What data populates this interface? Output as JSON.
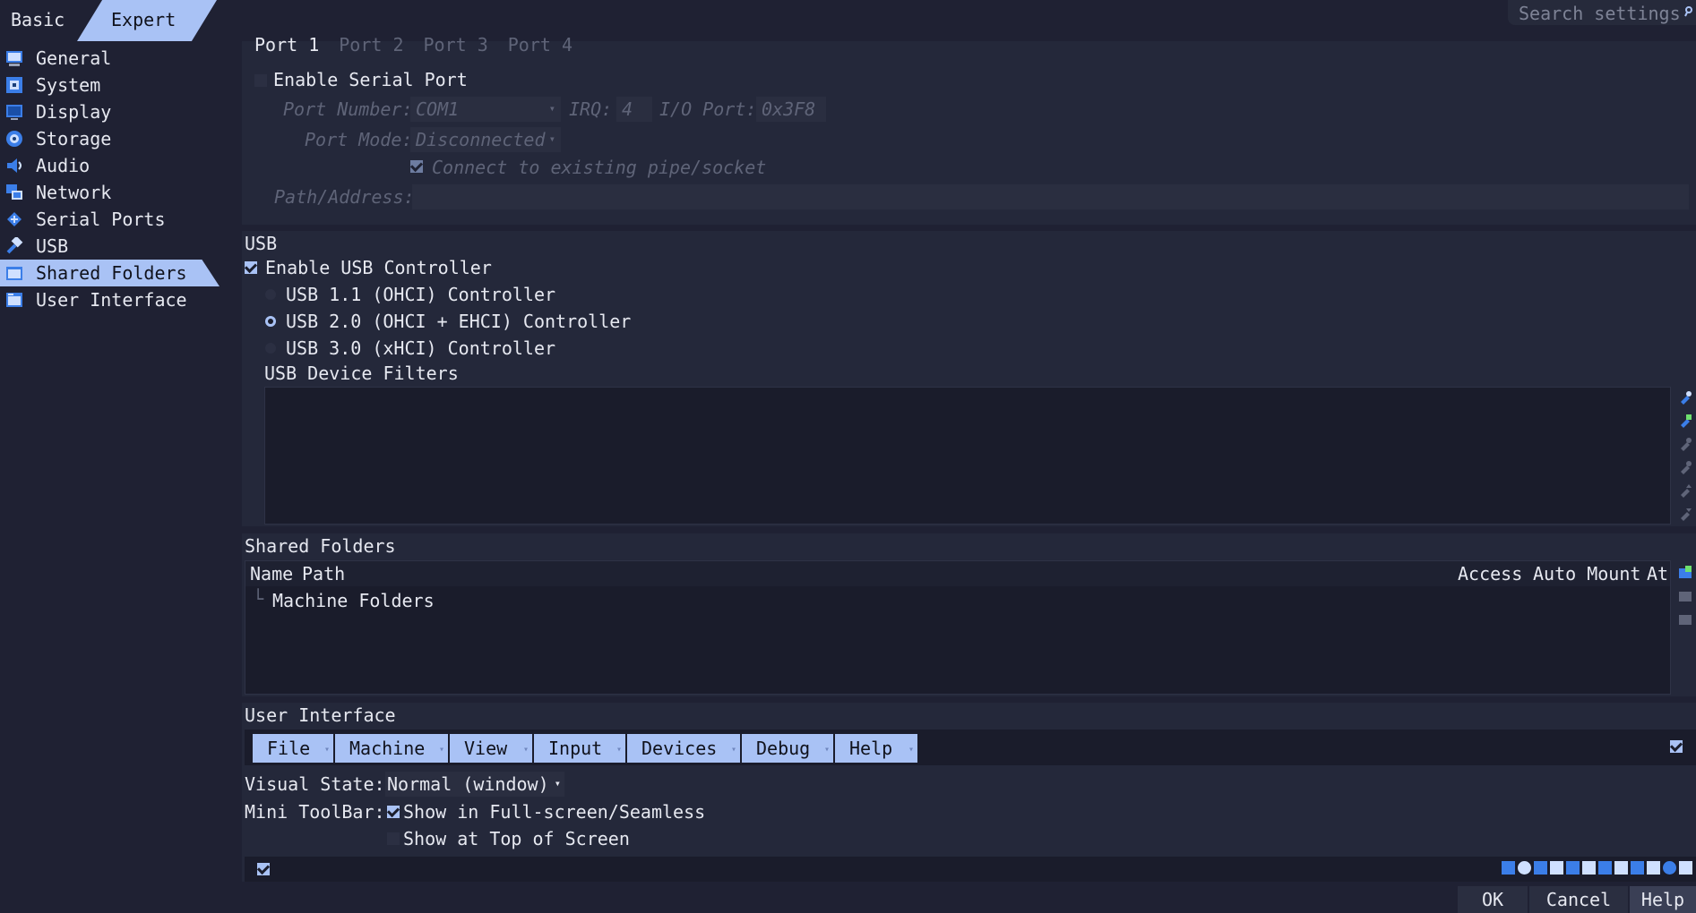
{
  "mode_tabs": {
    "basic": "Basic",
    "expert": "Expert"
  },
  "search": {
    "placeholder": "Search settings"
  },
  "sidebar": {
    "items": [
      {
        "label": "General",
        "icon": "general-icon"
      },
      {
        "label": "System",
        "icon": "system-icon"
      },
      {
        "label": "Display",
        "icon": "display-icon"
      },
      {
        "label": "Storage",
        "icon": "storage-icon"
      },
      {
        "label": "Audio",
        "icon": "audio-icon"
      },
      {
        "label": "Network",
        "icon": "network-icon"
      },
      {
        "label": "Serial Ports",
        "icon": "serial-ports-icon"
      },
      {
        "label": "USB",
        "icon": "usb-icon"
      },
      {
        "label": "Shared Folders",
        "icon": "shared-folders-icon",
        "selected": true
      },
      {
        "label": "User Interface",
        "icon": "user-interface-icon"
      }
    ]
  },
  "serial": {
    "port_tabs": [
      "Port 1",
      "Port 2",
      "Port 3",
      "Port 4"
    ],
    "enable_label": "Enable Serial Port",
    "port_number_label": "Port Number:",
    "port_number_value": "COM1",
    "irq_label": "IRQ:",
    "irq_value": "4",
    "io_port_label": "I/O Port:",
    "io_port_value": "0x3F8",
    "port_mode_label": "Port Mode:",
    "port_mode_value": "Disconnected",
    "connect_label": "Connect to existing pipe/socket",
    "path_label": "Path/Address:",
    "path_value": ""
  },
  "usb": {
    "title": "USB",
    "enable_label": "Enable USB Controller",
    "options": [
      "USB 1.1 (OHCI) Controller",
      "USB 2.0 (OHCI + EHCI) Controller",
      "USB 3.0 (xHCI) Controller"
    ],
    "selected_option": "USB 2.0 (OHCI + EHCI) Controller",
    "filters_label": "USB Device Filters"
  },
  "shared_folders": {
    "title": "Shared Folders",
    "columns": {
      "name": "Name",
      "path": "Path",
      "access": "Access",
      "auto_mount": "Auto Mount",
      "at": "At"
    },
    "tree_root": "Machine Folders"
  },
  "user_interface": {
    "title": "User Interface",
    "menus": [
      "File",
      "Machine",
      "View",
      "Input",
      "Devices",
      "Debug",
      "Help"
    ],
    "visual_state_label": "Visual State:",
    "visual_state_value": "Normal (window)",
    "mini_toolbar_label": "Mini ToolBar:",
    "show_fullscreen_label": "Show in Full-screen/Seamless",
    "show_top_label": "Show at Top of Screen"
  },
  "buttons": {
    "ok": "OK",
    "cancel": "Cancel",
    "help": "Help"
  },
  "colors": {
    "accent": "#a9c2f5",
    "background": "#1f2133",
    "panel": "#24283a"
  }
}
